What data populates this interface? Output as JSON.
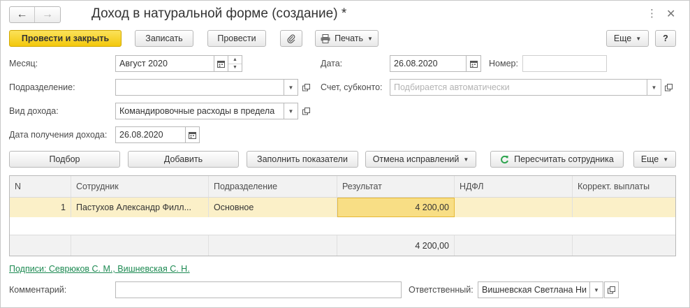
{
  "window": {
    "title": "Доход в натуральной форме (создание) *",
    "menu_icon": "vertical-dots-icon",
    "close_icon": "close-icon"
  },
  "nav": {
    "back_icon": "arrow-left-icon",
    "forward_icon": "arrow-right-icon"
  },
  "toolbar": {
    "post_and_close": "Провести и закрыть",
    "save": "Записать",
    "post": "Провести",
    "print": "Печать",
    "more": "Еще",
    "help": "?"
  },
  "form": {
    "month_label": "Месяц:",
    "month_value": "Август 2020",
    "date_label": "Дата:",
    "date_value": "26.08.2020",
    "number_label": "Номер:",
    "number_value": "",
    "department_label": "Подразделение:",
    "department_value": "",
    "account_label": "Счет, субконто:",
    "account_placeholder": "Подбирается автоматически",
    "income_type_label": "Вид дохода:",
    "income_type_value": "Командировочные расходы в предела",
    "income_date_label": "Дата получения дохода:",
    "income_date_value": "26.08.2020"
  },
  "table_toolbar": {
    "select": "Подбор",
    "add": "Добавить",
    "fill": "Заполнить показатели",
    "cancel_corrections": "Отмена исправлений",
    "recalculate": "Пересчитать сотрудника",
    "more": "Еще"
  },
  "table": {
    "columns": [
      "N",
      "Сотрудник",
      "Подразделение",
      "Результат",
      "НДФЛ",
      "Коррект. выплаты"
    ],
    "rows": [
      {
        "n": "1",
        "employee": "Пастухов Александр Филл...",
        "department": "Основное",
        "result": "4 200,00",
        "ndfl": "",
        "correction": ""
      }
    ],
    "total_result": "4 200,00"
  },
  "signatures_link": "Подписи: Севрюков С. М., Вишневская С. Н.",
  "footer": {
    "comment_label": "Комментарий:",
    "comment_value": "",
    "responsible_label": "Ответственный:",
    "responsible_value": "Вишневская Светлана Ни"
  },
  "colors": {
    "primary_button": "#f3c80c",
    "selected_row": "#fbf0c8",
    "link": "#1d8a52",
    "refresh_icon": "#2ea44f"
  }
}
